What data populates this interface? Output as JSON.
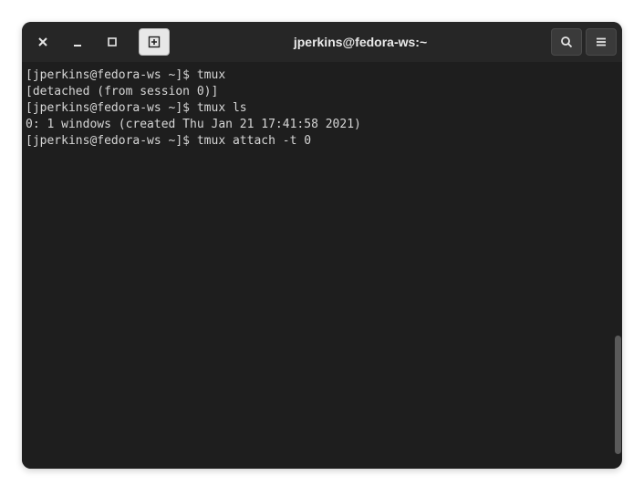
{
  "window": {
    "title": "jperkins@fedora-ws:~"
  },
  "icons": {
    "close": "close-icon",
    "minimize": "minimize-icon",
    "maximize": "maximize-icon",
    "new_tab": "new-tab-icon",
    "search": "search-icon",
    "menu": "menu-icon"
  },
  "terminal": {
    "lines": [
      {
        "prompt": "[jperkins@fedora-ws ~]$ ",
        "text": "tmux"
      },
      {
        "prompt": "",
        "text": "[detached (from session 0)]"
      },
      {
        "prompt": "[jperkins@fedora-ws ~]$ ",
        "text": "tmux ls"
      },
      {
        "prompt": "",
        "text": "0: 1 windows (created Thu Jan 21 17:41:58 2021)"
      },
      {
        "prompt": "[jperkins@fedora-ws ~]$ ",
        "text": "tmux attach -t 0"
      }
    ]
  }
}
